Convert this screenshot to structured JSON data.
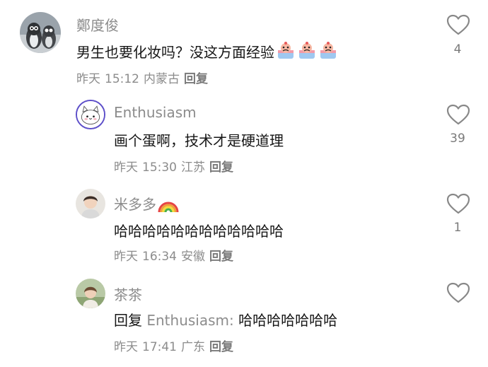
{
  "comments": [
    {
      "username": "鄭度俊",
      "text": "男生也要化妆吗？没这方面经验",
      "emojis": [
        "sad-cake-emoji",
        "sad-cake-emoji",
        "sad-cake-emoji"
      ],
      "date": "昨天",
      "time": "15:12",
      "location": "内蒙古",
      "reply_label": "回复",
      "likes": "4",
      "avatar_icon": "penguin-avatar"
    },
    {
      "username": "Enthusiasm",
      "text": "画个蛋啊，技术才是硬道理",
      "date": "昨天",
      "time": "15:30",
      "location": "江苏",
      "reply_label": "回复",
      "likes": "39",
      "avatar_icon": "cat-avatar"
    },
    {
      "username": "米多多",
      "username_emoji": "rainbow-emoji",
      "text": "哈哈哈哈哈哈哈哈哈哈哈哈",
      "date": "昨天",
      "time": "16:34",
      "location": "安徽",
      "reply_label": "回复",
      "likes": "1",
      "avatar_icon": "person-avatar"
    },
    {
      "username": "茶茶",
      "reply_prefix": "回复",
      "reply_target": "Enthusiasm:",
      "text": "哈哈哈哈哈哈哈",
      "date": "昨天",
      "time": "17:41",
      "location": "广东",
      "reply_label": "回复",
      "likes": "",
      "avatar_icon": "person-avatar"
    }
  ],
  "colors": {
    "secondary_text": "#8c8c8c",
    "primary_text": "#161616",
    "heart_outline": "#888888"
  }
}
